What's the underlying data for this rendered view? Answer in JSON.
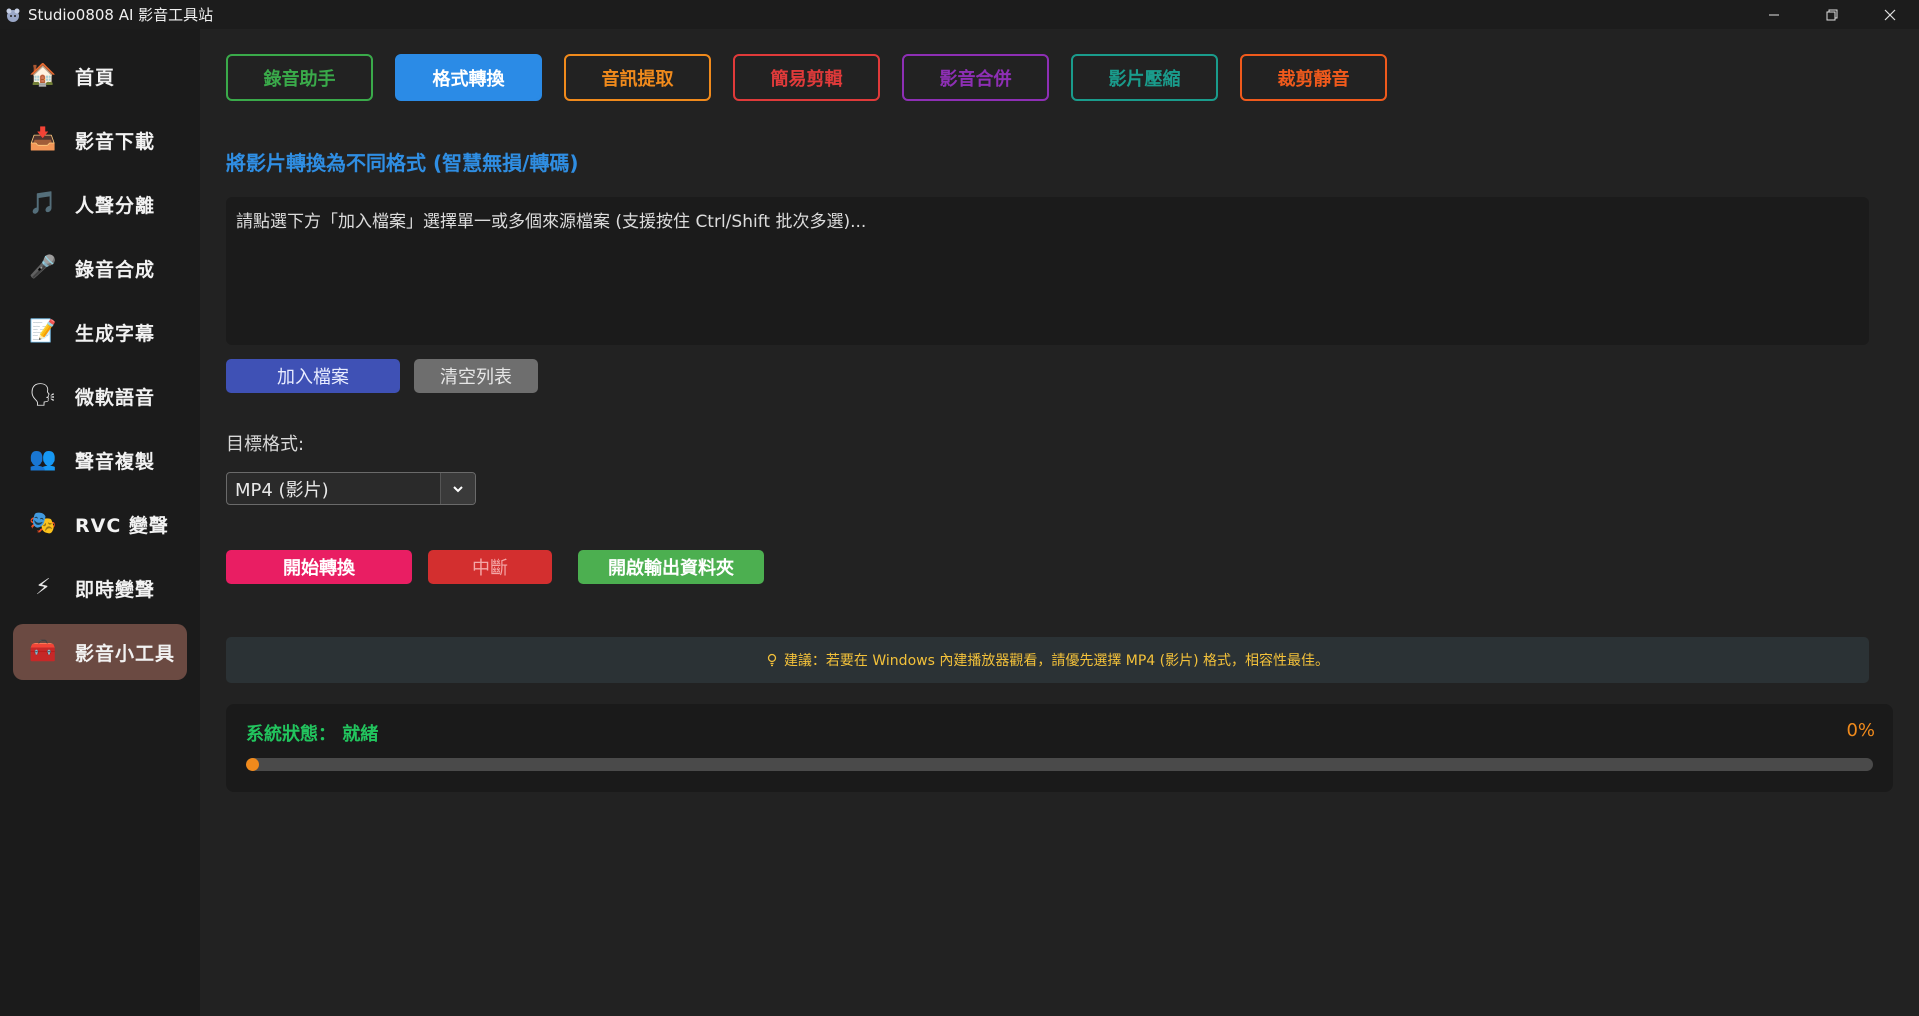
{
  "window": {
    "title": "Studio0808 AI 影音工具站",
    "controls": [
      "minimize",
      "restore",
      "close"
    ]
  },
  "sidebar": {
    "items": [
      {
        "label": "首頁",
        "icon": "home-icon",
        "glyph": "🏠",
        "active": false
      },
      {
        "label": "影音下載",
        "icon": "download-icon",
        "glyph": "📥",
        "active": false
      },
      {
        "label": "人聲分離",
        "icon": "music-note-icon",
        "glyph": "🎵",
        "active": false
      },
      {
        "label": "錄音合成",
        "icon": "microphone-icon",
        "glyph": "🎤",
        "active": false
      },
      {
        "label": "生成字幕",
        "icon": "memo-icon",
        "glyph": "📝",
        "active": false
      },
      {
        "label": "微軟語音",
        "icon": "speaking-head-icon",
        "glyph": "🗣",
        "active": false
      },
      {
        "label": "聲音複製",
        "icon": "people-icon",
        "glyph": "👥",
        "active": false
      },
      {
        "label": "RVC 變聲",
        "icon": "theater-masks-icon",
        "glyph": "🎭",
        "active": false
      },
      {
        "label": "即時變聲",
        "icon": "lightning-icon",
        "glyph": "⚡",
        "active": false
      },
      {
        "label": "影音小工具",
        "icon": "toolbox-icon",
        "glyph": "🧰",
        "active": true
      }
    ]
  },
  "tabs": [
    {
      "label": "錄音助手",
      "color": "#3aaa4a",
      "active": false
    },
    {
      "label": "格式轉換",
      "color": "#2b8be6",
      "active": true
    },
    {
      "label": "音訊提取",
      "color": "#f08a1c",
      "active": false
    },
    {
      "label": "簡易剪輯",
      "color": "#e03a3a",
      "active": false
    },
    {
      "label": "影音合併",
      "color": "#8e2fb5",
      "active": false
    },
    {
      "label": "影片壓縮",
      "color": "#1a9c8c",
      "active": false
    },
    {
      "label": "裁剪靜音",
      "color": "#f05a1c",
      "active": false
    }
  ],
  "convert": {
    "section_title": "將影片轉換為不同格式 (智慧無損/轉碼)",
    "file_list_placeholder": "請點選下方「加入檔案」選擇單一或多個來源檔案 (支援按住 Ctrl/Shift 批次多選)...",
    "add_files_label": "加入檔案",
    "clear_list_label": "清空列表",
    "target_format_label": "目標格式:",
    "target_format_value": "MP4 (影片)",
    "start_label": "開始轉換",
    "stop_label": "中斷",
    "open_output_label": "開啟輸出資料夾",
    "tip": "建議：若要在 Windows 內建播放器觀看，請優先選擇 MP4 (影片) 格式，相容性最佳。"
  },
  "status": {
    "label": "系統狀態： 就緒",
    "percent_text": "0%",
    "progress": 0
  },
  "colors": {
    "accent_blue": "#2b8be6",
    "add_button": "#3f51b5",
    "clear_button": "#6e6e6e",
    "start_button": "#e91e63",
    "stop_button": "#d32f2f",
    "open_button": "#4caf50",
    "status_green": "#22c55e",
    "progress_orange": "#f08a1c",
    "tip_yellow": "#f3c13a",
    "active_nav": "#6b4a42"
  }
}
